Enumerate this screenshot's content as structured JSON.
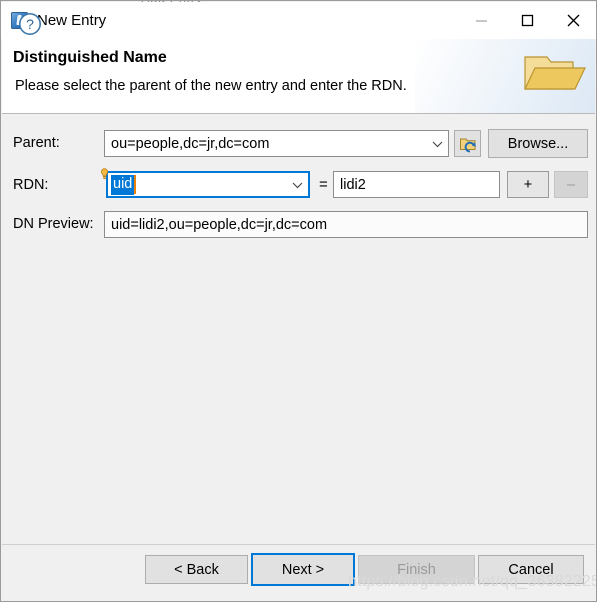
{
  "window": {
    "title": "New Entry",
    "app_icon": "ldap-browser-icon",
    "controls": {
      "minimize": "minimize-icon",
      "maximize": "maximize-icon",
      "close": "close-icon"
    },
    "top_artifact": "Add Entry"
  },
  "banner": {
    "title": "Distinguished Name",
    "subtitle": "Please select the parent of the new entry and enter the RDN.",
    "icon": "open-folder-icon"
  },
  "form": {
    "parent": {
      "label": "Parent:",
      "value": "ou=people,dc=jr,dc=com",
      "dropdown_icon": "chevron-down-icon",
      "reload_button_icon": "folder-refresh-icon",
      "browse_label": "Browse..."
    },
    "rdn": {
      "label": "RDN:",
      "attribute": "uid",
      "attribute_selected": true,
      "content_assist_icon": "lightbulb-icon",
      "dropdown_icon": "chevron-down-icon",
      "equals": "=",
      "value": "lidi2",
      "add_label": "+",
      "remove_label": "–",
      "remove_enabled": false
    },
    "dn_preview": {
      "label": "DN Preview:",
      "value": "uid=lidi2,ou=people,dc=jr,dc=com"
    }
  },
  "footer": {
    "help_icon": "help-circle-icon",
    "back_label": "< Back",
    "next_label": "Next >",
    "next_focused": true,
    "finish_label": "Finish",
    "finish_enabled": false,
    "cancel_label": "Cancel"
  },
  "watermark": "https://blog.csdn.net/qq_36382225",
  "colors": {
    "accent": "#0078D7",
    "selection": "#0078D7",
    "caret": "#E8820C",
    "dialog_bg": "#F0F0F0",
    "banner_bg": "#FFFFFF",
    "button_bg": "#E1E1E1",
    "disabled_text": "#9A9A9A",
    "folder_gold": "#E8C560"
  }
}
